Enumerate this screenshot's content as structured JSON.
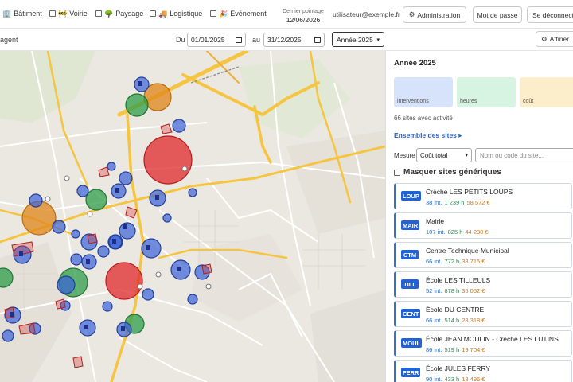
{
  "filters": [
    {
      "label": "Bâtiment",
      "icon": "building-icon",
      "checked": false
    },
    {
      "label": "Voirie",
      "icon": "road-barrier-icon",
      "checked": false
    },
    {
      "label": "Paysage",
      "icon": "tree-icon",
      "checked": false
    },
    {
      "label": "Logistique",
      "icon": "truck-icon",
      "checked": false
    },
    {
      "label": "Événement",
      "icon": "party-icon",
      "checked": false
    }
  ],
  "pointage": {
    "label": "Dernier pointage",
    "date": "12/06/2026"
  },
  "user": {
    "email": "utilisateur@exemple.fr"
  },
  "buttons": {
    "admin": "Administration",
    "password": "Mot de passe",
    "logout": "Se déconnecter",
    "refine": "Affiner"
  },
  "toolbar": {
    "left_label": "agent",
    "from_label": "Du",
    "from_value": "01/01/2025",
    "to_label": "au",
    "to_value": "31/12/2025",
    "year": "Année 2025"
  },
  "panel": {
    "title": "Année 2025",
    "kpis": [
      {
        "label": "interventions",
        "color": "#d6e3fb"
      },
      {
        "label": "heures",
        "color": "#d7f3e1"
      },
      {
        "label": "coût",
        "color": "#fdeecb"
      }
    ],
    "sites_count": "66 sites avec activité",
    "ensemble": "Ensemble des sites",
    "mesure_label": "Mesure",
    "mesure_value": "Coût total",
    "search_placeholder": "Nom ou code du site...",
    "masquer_label": "Masquer sites génériques",
    "masquer_checked": false
  },
  "sites": [
    {
      "code": "LOUP",
      "name": "Crèche LES PETITS LOUPS",
      "interventions": "38 int.",
      "hours": "1 239 h",
      "cost": "58 572 €"
    },
    {
      "code": "MAIR",
      "name": "Mairie",
      "interventions": "107 int.",
      "hours": "825 h",
      "cost": "44 230 €"
    },
    {
      "code": "CTM",
      "name": "Centre Technique Municipal",
      "interventions": "66 int.",
      "hours": "772 h",
      "cost": "38 715 €"
    },
    {
      "code": "TILL",
      "name": "École LES TILLEULS",
      "interventions": "52 int.",
      "hours": "878 h",
      "cost": "35 052 €"
    },
    {
      "code": "CENT",
      "name": "École DU CENTRE",
      "interventions": "66 int.",
      "hours": "514 h",
      "cost": "28 318 €"
    },
    {
      "code": "MOUL",
      "name": "École JEAN MOULIN - Crèche LES LUTINS",
      "interventions": "86 int.",
      "hours": "519 h",
      "cost": "19 704 €"
    },
    {
      "code": "FERR",
      "name": "École JULES FERRY",
      "interventions": "90 int.",
      "hours": "433 h",
      "cost": "18 496 €"
    }
  ],
  "colors": {
    "accent": "#2162d6",
    "red_marker": "#e0282a",
    "orange_marker": "#e0861a",
    "green_marker": "#2e9e48",
    "blue_marker": "#3a63d8",
    "major_road": "#f5c542"
  }
}
